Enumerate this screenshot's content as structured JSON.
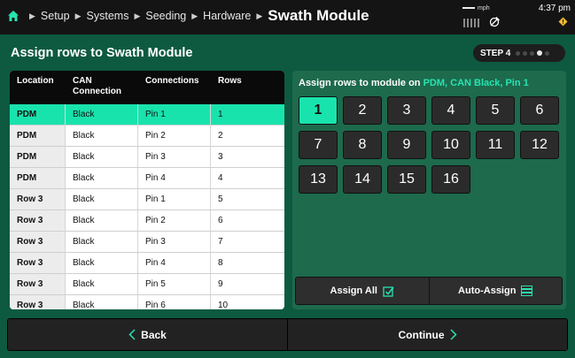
{
  "header": {
    "breadcrumbs": [
      "Setup",
      "Systems",
      "Seeding",
      "Hardware"
    ],
    "current": "Swath Module",
    "speed_unit": "mph",
    "time": "4:37 pm",
    "icons": [
      "home-icon",
      "gps-off-icon",
      "warning-icon"
    ]
  },
  "page": {
    "title": "Assign rows to Swath Module",
    "step_label": "STEP 4",
    "step_total": 5,
    "step_active": 4
  },
  "table": {
    "headers": [
      "Location",
      "CAN Connection",
      "Connections",
      "Rows"
    ],
    "rows": [
      {
        "location": "PDM",
        "can": "Black",
        "connection": "Pin 1",
        "row": "1"
      },
      {
        "location": "PDM",
        "can": "Black",
        "connection": "Pin 2",
        "row": "2"
      },
      {
        "location": "PDM",
        "can": "Black",
        "connection": "Pin 3",
        "row": "3"
      },
      {
        "location": "PDM",
        "can": "Black",
        "connection": "Pin 4",
        "row": "4"
      },
      {
        "location": "Row 3",
        "can": "Black",
        "connection": "Pin 1",
        "row": "5"
      },
      {
        "location": "Row 3",
        "can": "Black",
        "connection": "Pin 2",
        "row": "6"
      },
      {
        "location": "Row 3",
        "can": "Black",
        "connection": "Pin 3",
        "row": "7"
      },
      {
        "location": "Row 3",
        "can": "Black",
        "connection": "Pin 4",
        "row": "8"
      },
      {
        "location": "Row 3",
        "can": "Black",
        "connection": "Pin 5",
        "row": "9"
      },
      {
        "location": "Row 3",
        "can": "Black",
        "connection": "Pin 6",
        "row": "10"
      }
    ]
  },
  "panel": {
    "title_prefix": "Assign rows to module on ",
    "title_highlight": "PDM, CAN Black, Pin 1",
    "rows": [
      "1",
      "2",
      "3",
      "4",
      "5",
      "6",
      "7",
      "8",
      "9",
      "10",
      "11",
      "12",
      "13",
      "14",
      "15",
      "16"
    ],
    "selected_row": "1",
    "assign_all_label": "Assign All",
    "auto_assign_label": "Auto-Assign"
  },
  "nav": {
    "back_label": "Back",
    "continue_label": "Continue"
  },
  "colors": {
    "accent": "#19e3ad",
    "background": "#0d5a40",
    "panel": "#1d6a4d"
  }
}
